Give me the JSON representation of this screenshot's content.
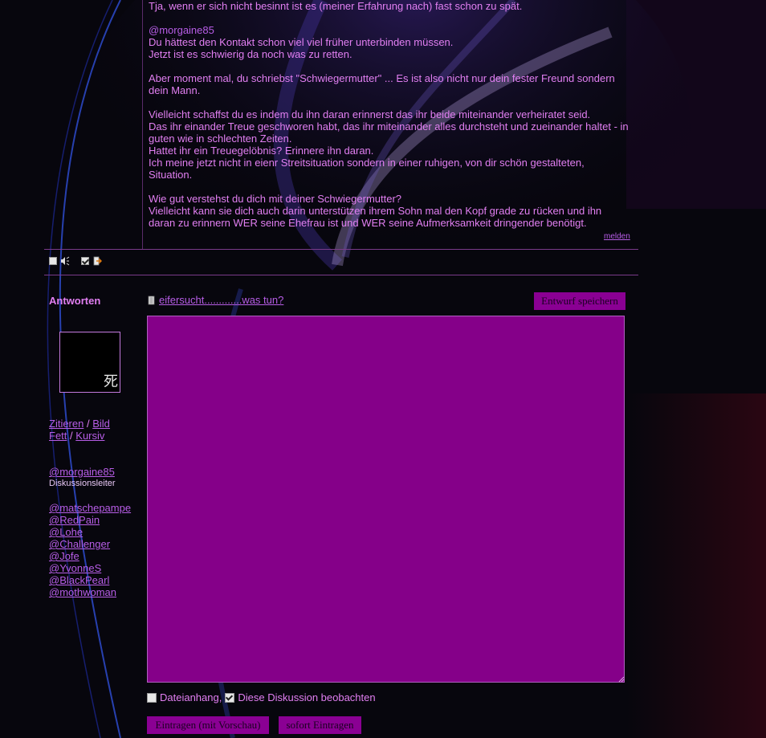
{
  "post": {
    "lines": [
      "Tja, wenn er sich nicht besinnt ist es (meiner Erfahrung nach) fast schon zu spät.",
      "",
      "@morgaine85",
      "Du hättest den Kontakt schon viel viel früher unterbinden müssen.",
      "Jetzt ist es schwierig da noch was zu retten.",
      "",
      "Aber moment mal, du schriebst \"Schwiegermutter\" ... Es ist also nicht nur dein fester Freund sondern dein Mann.",
      "",
      "Vielleicht schaffst du es indem du ihn daran erinnerst das ihr beide miteinander verheiratet seid.",
      "Das ihr einander Treue geschworen habt, das ihr miteinander alles durchsteht und zueinander haltet - in guten wie in schlechten Zeiten.",
      "Hattet ihr ein Treuegelöbnis? Erinnere ihn daran.",
      "Ich meine jetzt nicht in eienr Streitsituation sondern in einer ruhigen, von dir schön gestalteten, Situation.",
      "",
      "Wie gut verstehst du dich mit deiner Schwiegermutter?",
      "Vielleicht kann sie dich auch darin unterstützen ihrem Sohn mal den Kopf grade zu rücken und ihn daran zu erinnern WER seine Ehefrau ist und WER seine Aufmerksamkeit dringender benötigt."
    ],
    "report_label": "melden"
  },
  "reply": {
    "heading": "Antworten",
    "avatar_glyph": "死",
    "format": {
      "quote": "Zitieren",
      "image": "Bild",
      "bold": "Fett",
      "italic": "Kursiv",
      "separator": "/"
    },
    "moderator": {
      "name": "@morgaine85",
      "role": "Diskussionsleiter"
    },
    "mentions": [
      "@matschepampe",
      "@RedPain",
      "@Lohe",
      "@Challenger",
      "@Jofe",
      "@YvonneS",
      "@BlackPearl",
      "@mothwoman"
    ]
  },
  "composer": {
    "thread_title": "eifersucht.............was tun?",
    "draft_button": "Entwurf speichern",
    "message_value": "",
    "attachment_label": "Dateianhang,",
    "watch_label": "Diese Diskussion beobachten",
    "watch_checked": true,
    "submit_preview": "Eintragen (mit Vorschau)",
    "submit_now": "sofort Eintragen"
  },
  "colors": {
    "accent": "#8a0093",
    "text": "#e27ff2",
    "link": "#b75de6",
    "background": "#07060d"
  }
}
